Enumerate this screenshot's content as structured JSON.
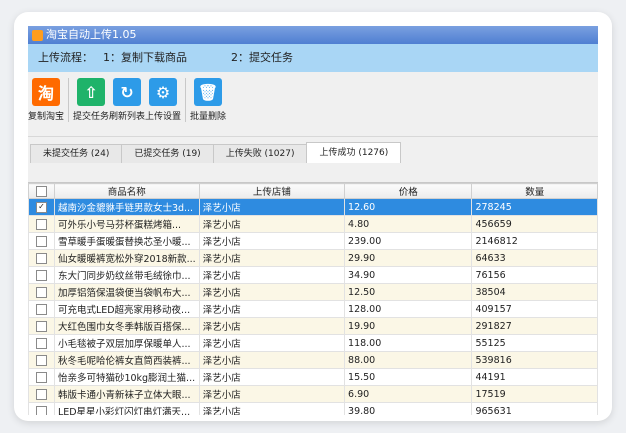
{
  "window": {
    "title": "淘宝自动上传1.05"
  },
  "flow": {
    "label": "上传流程：",
    "step1": "1：复制下载商品",
    "step2": "2：提交任务"
  },
  "toolbar": [
    {
      "label": "复制淘宝",
      "icon": "taobao-icon",
      "color": "#ff6a00",
      "glyph": "淘"
    },
    {
      "label": "提交任务",
      "icon": "upload-icon",
      "color": "#1fb36a",
      "glyph": "⇧"
    },
    {
      "label": "刷新列表",
      "icon": "refresh-icon",
      "color": "#2d9be8",
      "glyph": "↻"
    },
    {
      "label": "上传设置",
      "icon": "gear-icon",
      "color": "#2d9be8",
      "glyph": "⚙"
    },
    {
      "label": "批量删除",
      "icon": "trash-icon",
      "color": "#2d9be8",
      "glyph": "🗑"
    }
  ],
  "tabs": [
    "未提交任务 (24)",
    "已提交任务 (19)",
    "上传失败 (1027)",
    "上传成功 (1276)"
  ],
  "table": {
    "columns": [
      "",
      "商品名称",
      "上传店铺",
      "价格",
      "数量"
    ],
    "rows": [
      {
        "checked": true,
        "name": "越南沙金貔貅手链男款女士3d...",
        "shop": "泽艺小店",
        "price": "12.60",
        "qty": "278245"
      },
      {
        "checked": false,
        "name": "可外乐小号马芬杯蛋糕烤箱...",
        "shop": "泽艺小店",
        "price": "4.80",
        "qty": "456659"
      },
      {
        "checked": false,
        "name": "雪草暖手蛋暖蛋替换芯圣小暖...",
        "shop": "泽艺小店",
        "price": "239.00",
        "qty": "2146812"
      },
      {
        "checked": false,
        "name": "仙女暖暖裤宽松外穿2018新款...",
        "shop": "泽艺小店",
        "price": "29.90",
        "qty": "64633"
      },
      {
        "checked": false,
        "name": "东大门同步奶纹丝带毛绒徐巾...",
        "shop": "泽艺小店",
        "price": "34.90",
        "qty": "76156"
      },
      {
        "checked": false,
        "name": "加厚铝箔保温袋便当袋帆布大...",
        "shop": "泽艺小店",
        "price": "12.50",
        "qty": "38504"
      },
      {
        "checked": false,
        "name": "可充电式LED超亮家用移动夜...",
        "shop": "泽艺小店",
        "price": "128.00",
        "qty": "409157"
      },
      {
        "checked": false,
        "name": "大红色围巾女冬季韩版百搭保...",
        "shop": "泽艺小店",
        "price": "19.90",
        "qty": "291827"
      },
      {
        "checked": false,
        "name": "小毛毯被子双层加厚保暖单人...",
        "shop": "泽艺小店",
        "price": "118.00",
        "qty": "55125"
      },
      {
        "checked": false,
        "name": "秋冬毛呢哈伦裤女直筒西装裤...",
        "shop": "泽艺小店",
        "price": "88.00",
        "qty": "539816"
      },
      {
        "checked": false,
        "name": "怡亲多可特猫砂10kg膨润土猫...",
        "shop": "泽艺小店",
        "price": "15.50",
        "qty": "44191"
      },
      {
        "checked": false,
        "name": "韩版卡通小青新袜子立体大眼...",
        "shop": "泽艺小店",
        "price": "6.90",
        "qty": "17519"
      },
      {
        "checked": false,
        "name": "LED星星小彩灯闪灯串灯满天...",
        "shop": "泽艺小店",
        "price": "39.80",
        "qty": "965631"
      }
    ]
  }
}
